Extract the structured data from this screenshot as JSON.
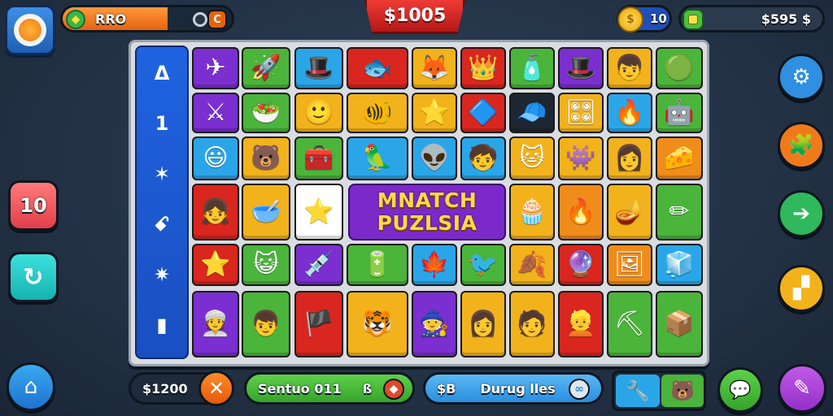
{
  "hud": {
    "energy": {
      "label": "RRO",
      "fill_percent": 62,
      "c_label": "C"
    },
    "top_price": "$1005",
    "coins": {
      "value": "10"
    },
    "cash": {
      "value": "$595 $"
    }
  },
  "board": {
    "sidebar_items": [
      "Δ",
      "1",
      "✶",
      "ꗃ",
      "✷",
      "▮"
    ],
    "banner_lines": [
      "MNATCH",
      "PUZLSIA"
    ],
    "rows": [
      [
        {
          "color": "#7b2fd0",
          "icon": "paper-plane-icon",
          "glyph": "✈"
        },
        {
          "color": "#4bb43a",
          "icon": "rocket-icon",
          "glyph": "🚀"
        },
        {
          "color": "#2aa6e8",
          "icon": "face-hat-icon",
          "glyph": "🎩"
        },
        {
          "color": "#d9261f",
          "icon": "fish-icon",
          "glyph": "🐟"
        },
        {
          "color": "#f2b21c",
          "icon": "fox-icon",
          "glyph": "🦊"
        },
        {
          "color": "#d9261f",
          "icon": "king-face-icon",
          "glyph": "👑"
        },
        {
          "color": "#4bb43a",
          "icon": "bottle-icon",
          "glyph": "🧴"
        },
        {
          "color": "#7b2fd0",
          "icon": "top-hat-face-icon",
          "glyph": "🎩"
        },
        {
          "color": "#f2b21c",
          "icon": "boy-face-icon",
          "glyph": "👦"
        },
        {
          "color": "#4bb43a",
          "icon": "coin-pad-icon",
          "glyph": "🟢"
        }
      ],
      [
        {
          "color": "#7b2fd0",
          "icon": "sword-icon",
          "glyph": "⚔"
        },
        {
          "color": "#4bb43a",
          "icon": "bowl-icon",
          "glyph": "🥗"
        },
        {
          "color": "#f2b21c",
          "icon": "boy-face-icon",
          "glyph": "🙂"
        },
        {
          "color": "#f2b21c",
          "icon": "fish-icon",
          "glyph": "🐠"
        },
        {
          "color": "#f2b21c",
          "icon": "star-pieces-icon",
          "glyph": "⭐"
        },
        {
          "color": "#d9261f",
          "icon": "gem-icon",
          "glyph": "🔷"
        },
        {
          "color": "#1d2733",
          "icon": "face-cap-icon",
          "glyph": "🧢"
        },
        {
          "color": "#f2b21c",
          "icon": "console-icon",
          "glyph": "🎛"
        },
        {
          "color": "#2aa6e8",
          "icon": "flame-icon",
          "glyph": "🔥"
        },
        {
          "color": "#4bb43a",
          "icon": "robot-icon",
          "glyph": "🤖"
        }
      ],
      [
        {
          "color": "#2aa6e8",
          "icon": "smile-face-icon",
          "glyph": "😃"
        },
        {
          "color": "#f2b21c",
          "icon": "bear-icon",
          "glyph": "🐻"
        },
        {
          "color": "#4bb43a",
          "icon": "chest-icon",
          "glyph": "🧰"
        },
        {
          "color": "#2aa6e8",
          "icon": "parrot-icon",
          "glyph": "🦜"
        },
        {
          "color": "#2aa6e8",
          "icon": "alien-icon",
          "glyph": "👽"
        },
        {
          "color": "#2aa6e8",
          "icon": "kid-face-icon",
          "glyph": "🧒"
        },
        {
          "color": "#f2b21c",
          "icon": "cat-girl-icon",
          "glyph": "🐱"
        },
        {
          "color": "#f2b21c",
          "icon": "blue-creature-icon",
          "glyph": "👾"
        },
        {
          "color": "#f2b21c",
          "icon": "red-hair-face-icon",
          "glyph": "👩"
        },
        {
          "color": "#f08c1a",
          "icon": "cheese-icon",
          "glyph": "🧀"
        }
      ],
      [
        {
          "color": "#d9261f",
          "icon": "girl-hat-icon",
          "glyph": "👧"
        },
        {
          "color": "#f2b21c",
          "icon": "red-bowl-icon",
          "glyph": "🥣"
        },
        {
          "color": "#ffffff",
          "icon": "star-icon",
          "glyph": "⭐"
        },
        {
          "color": null,
          "icon": "",
          "glyph": ""
        },
        {
          "color": null,
          "icon": "",
          "glyph": ""
        },
        {
          "color": "#f2b21c",
          "icon": "cupcake-icon",
          "glyph": "🧁"
        },
        {
          "color": "#f08c1a",
          "icon": "fire-icon",
          "glyph": "🔥"
        },
        {
          "color": "#f2b21c",
          "icon": "lamp-icon",
          "glyph": "🪔"
        },
        {
          "color": "#4bb43a",
          "icon": "pencil-icon",
          "glyph": "✏"
        }
      ],
      [
        {
          "color": "#d9261f",
          "icon": "gold-star-icon",
          "glyph": "⭐"
        },
        {
          "color": "#4bb43a",
          "icon": "cat-face-icon",
          "glyph": "😺"
        },
        {
          "color": "#7b2fd0",
          "icon": "syringe-icon",
          "glyph": "💉"
        },
        {
          "color": "#4bb43a",
          "icon": "battery-icon",
          "glyph": "🔋"
        },
        {
          "color": "#2aa6e8",
          "icon": "leaf-icon",
          "glyph": "🍁"
        },
        {
          "color": "#4bb43a",
          "icon": "bird-icon",
          "glyph": "🐦"
        },
        {
          "color": "#f2b21c",
          "icon": "leaf-red-icon",
          "glyph": "🍂"
        },
        {
          "color": "#d9261f",
          "icon": "orb-icon",
          "glyph": "🔮"
        },
        {
          "color": "#f08c1a",
          "icon": "frame-icon",
          "glyph": "🖼"
        },
        {
          "color": "#2aa6e8",
          "icon": "block-icon",
          "glyph": "🧊"
        }
      ],
      [
        {
          "color": "#7b2fd0",
          "icon": "turban-girl-icon",
          "glyph": "👳"
        },
        {
          "color": "#4bb43a",
          "icon": "boy-face-icon",
          "glyph": "👦"
        },
        {
          "color": "#d9261f",
          "icon": "pirate-icon",
          "glyph": "🏴"
        },
        {
          "color": "#f2b21c",
          "icon": "tiger-icon",
          "glyph": "🐯"
        },
        {
          "color": "#7b2fd0",
          "icon": "wizard-hat-icon",
          "glyph": "🧙"
        },
        {
          "color": "#f2b21c",
          "icon": "red-hair-girl-icon",
          "glyph": "👩"
        },
        {
          "color": "#f2b21c",
          "icon": "blue-hair-girl-icon",
          "glyph": "🧑"
        },
        {
          "color": "#d9261f",
          "icon": "blue-hair-face-icon",
          "glyph": "👱"
        },
        {
          "color": "#4bb43a",
          "icon": "shovel-icon",
          "glyph": "⛏"
        },
        {
          "color": "#4bb43a",
          "icon": "crate-icon",
          "glyph": "📦"
        }
      ]
    ]
  },
  "left_buttons": {
    "level": "10",
    "refresh_glyph": "↻"
  },
  "right_buttons": [
    {
      "name": "settings",
      "glyph": "⚙",
      "color": "#2f8fe0"
    },
    {
      "name": "puzzle",
      "glyph": "🧩",
      "color": "#f07a1a"
    },
    {
      "name": "next",
      "glyph": "➔",
      "color": "#2fb85c"
    },
    {
      "name": "hint",
      "glyph": "▞",
      "color": "#f2b21c"
    }
  ],
  "bottom": {
    "score": "$1200",
    "status": {
      "label": "Sentuo 011",
      "suffix": "ß"
    },
    "dialog": {
      "prefix": "$B",
      "label": "Durug lles"
    },
    "item1_glyph": "🔧",
    "item2_glyph": "🐻",
    "chat_glyph": "💬",
    "shop_glyph": "✎"
  },
  "colors": {
    "accent_red": "#d9261f",
    "accent_purple": "#7b2fd0",
    "accent_blue": "#1f63e0"
  }
}
